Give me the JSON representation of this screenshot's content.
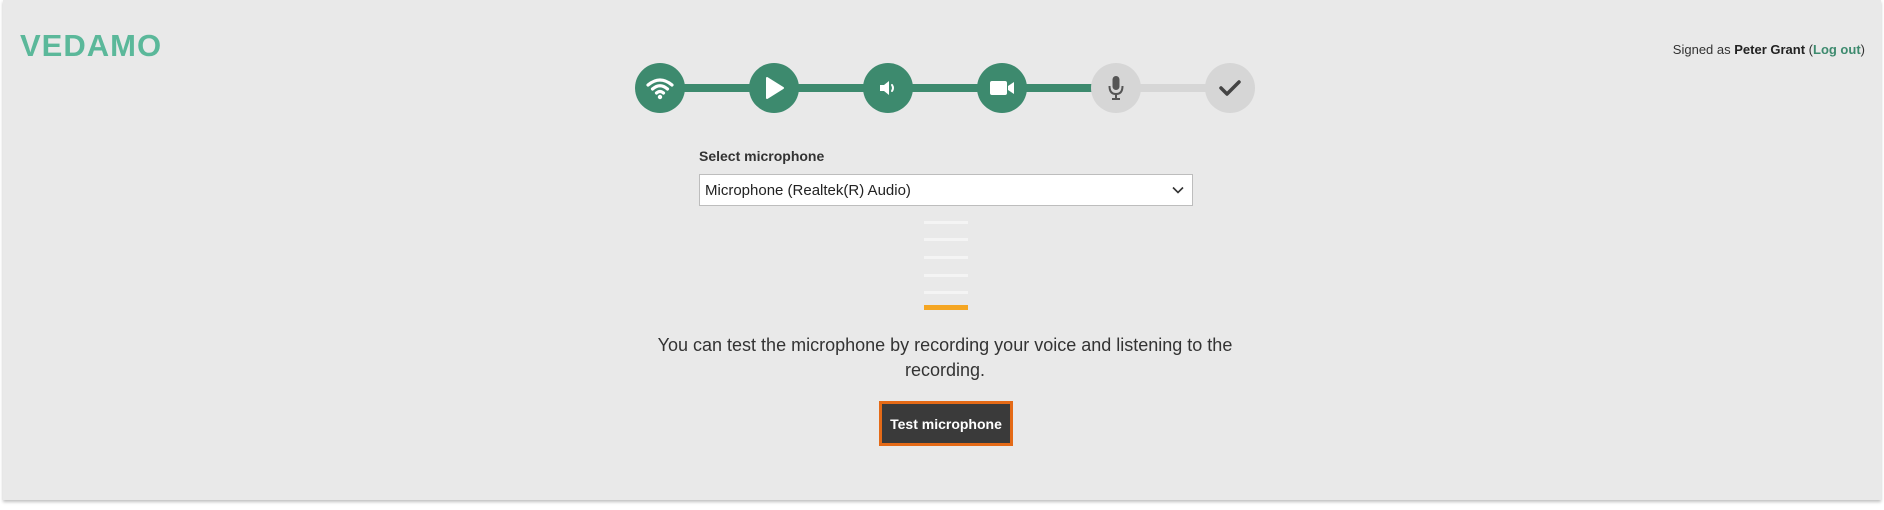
{
  "brand": {
    "logo_text": "VEDAMO"
  },
  "user": {
    "signed_prefix": "Signed as ",
    "name": "Peter Grant",
    "open_paren": " (",
    "logout_label": "Log out",
    "close_paren": ")"
  },
  "stepper": {
    "steps": [
      {
        "icon": "wifi-icon",
        "state": "done"
      },
      {
        "icon": "play-icon",
        "state": "done"
      },
      {
        "icon": "speaker-icon",
        "state": "done"
      },
      {
        "icon": "video-camera-icon",
        "state": "done"
      },
      {
        "icon": "microphone-icon",
        "state": "current"
      },
      {
        "icon": "checkmark-icon",
        "state": "todo"
      }
    ],
    "colors": {
      "done": "#3d8a6e",
      "todo": "#d6d6d6"
    }
  },
  "microphone": {
    "label": "Select microphone",
    "selected": "Microphone (Realtek(R) Audio)",
    "level_bars": 6,
    "active_bars": 1,
    "level_color": "#f5a623"
  },
  "hint_text": "You can test the microphone by recording your voice and listening to the recording.",
  "test_button_label": "Test microphone",
  "colors": {
    "accent": "#3d8a6e",
    "focus_outline": "#e46a17",
    "button_bg": "#3a3a3a"
  }
}
